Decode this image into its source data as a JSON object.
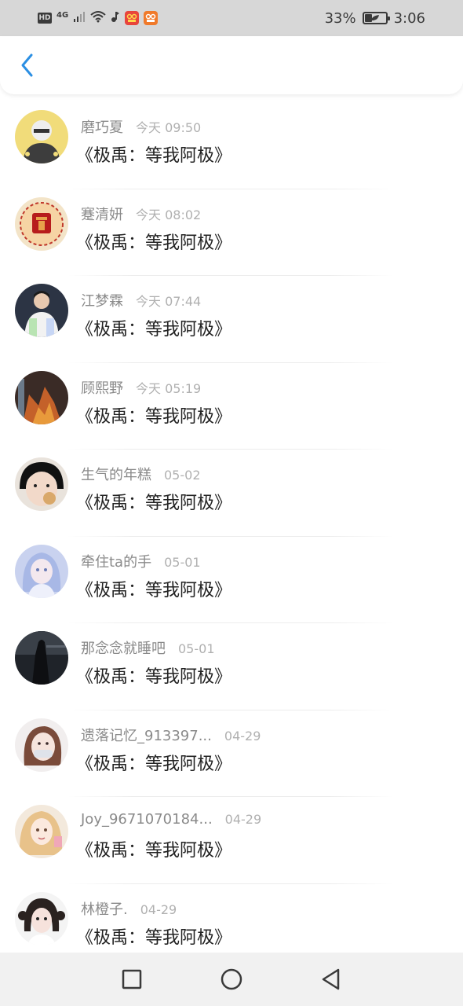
{
  "status_bar": {
    "hd": "HD",
    "network": "4G",
    "battery_percent": "33%",
    "battery_level": 0.33,
    "time": "3:06",
    "icons": [
      "hd-icon",
      "signal-icon",
      "wifi-icon",
      "music-icon",
      "app-badge-icon",
      "app-badge-icon",
      "battery-icon"
    ]
  },
  "header": {
    "back_icon": "chevron-left-icon",
    "accent_color": "#2b8fe3"
  },
  "items": [
    {
      "username": "磨巧夏",
      "time": "今天 09:50",
      "message": "《极禹：等我阿极》"
    },
    {
      "username": "蹇清妍",
      "time": "今天 08:02",
      "message": "《极禹：等我阿极》"
    },
    {
      "username": "江梦霖",
      "time": "今天 07:44",
      "message": "《极禹：等我阿极》"
    },
    {
      "username": "顾熙野",
      "time": "今天 05:19",
      "message": "《极禹：等我阿极》"
    },
    {
      "username": "生气的年糕",
      "time": "05-02",
      "message": "《极禹：等我阿极》"
    },
    {
      "username": "牵住ta的手",
      "time": "05-01",
      "message": "《极禹：等我阿极》"
    },
    {
      "username": "那念念就睡吧",
      "time": "05-01",
      "message": "《极禹：等我阿极》"
    },
    {
      "username": "遗落记忆_913397...",
      "time": "04-29",
      "message": "《极禹：等我阿极》"
    },
    {
      "username": "Joy_9671070184...",
      "time": "04-29",
      "message": "《极禹：等我阿极》"
    },
    {
      "username": "林橙子.",
      "time": "04-29",
      "message": "《极禹：等我阿极》"
    }
  ],
  "nav_bar": {
    "icons": [
      "square-icon",
      "circle-icon",
      "triangle-back-icon"
    ]
  }
}
